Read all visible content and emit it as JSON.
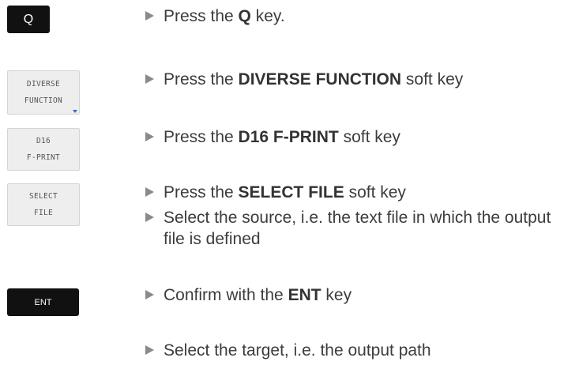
{
  "keys": {
    "q": "Q",
    "diverse_line1": "DIVERSE",
    "diverse_line2": "FUNCTION",
    "d16_line1": "D16",
    "d16_line2": "F-PRINT",
    "select_line1": "SELECT",
    "select_line2": "FILE",
    "ent": "ENT"
  },
  "steps": [
    {
      "pre": "Press the ",
      "bold": "Q",
      "post": " key."
    },
    {
      "pre": "Press the ",
      "bold": "DIVERSE FUNCTION",
      "post": " soft key"
    },
    {
      "pre": "Press the ",
      "bold": "D16 F-PRINT",
      "post": " soft key"
    },
    {
      "pre": "Press the ",
      "bold": "SELECT FILE",
      "post": " soft key"
    },
    {
      "text": "Select the source, i.e. the text file in which the output file is defined"
    },
    {
      "pre": "Confirm with the ",
      "bold": "ENT",
      "post": " key"
    },
    {
      "text": "Select the target, i.e. the output path"
    }
  ],
  "colors": {
    "hard_key": "#111111",
    "soft_key_bg": "#eeeeee",
    "bullet": "#8a8a8a",
    "soft_key_marker": "#2a6fd0"
  }
}
